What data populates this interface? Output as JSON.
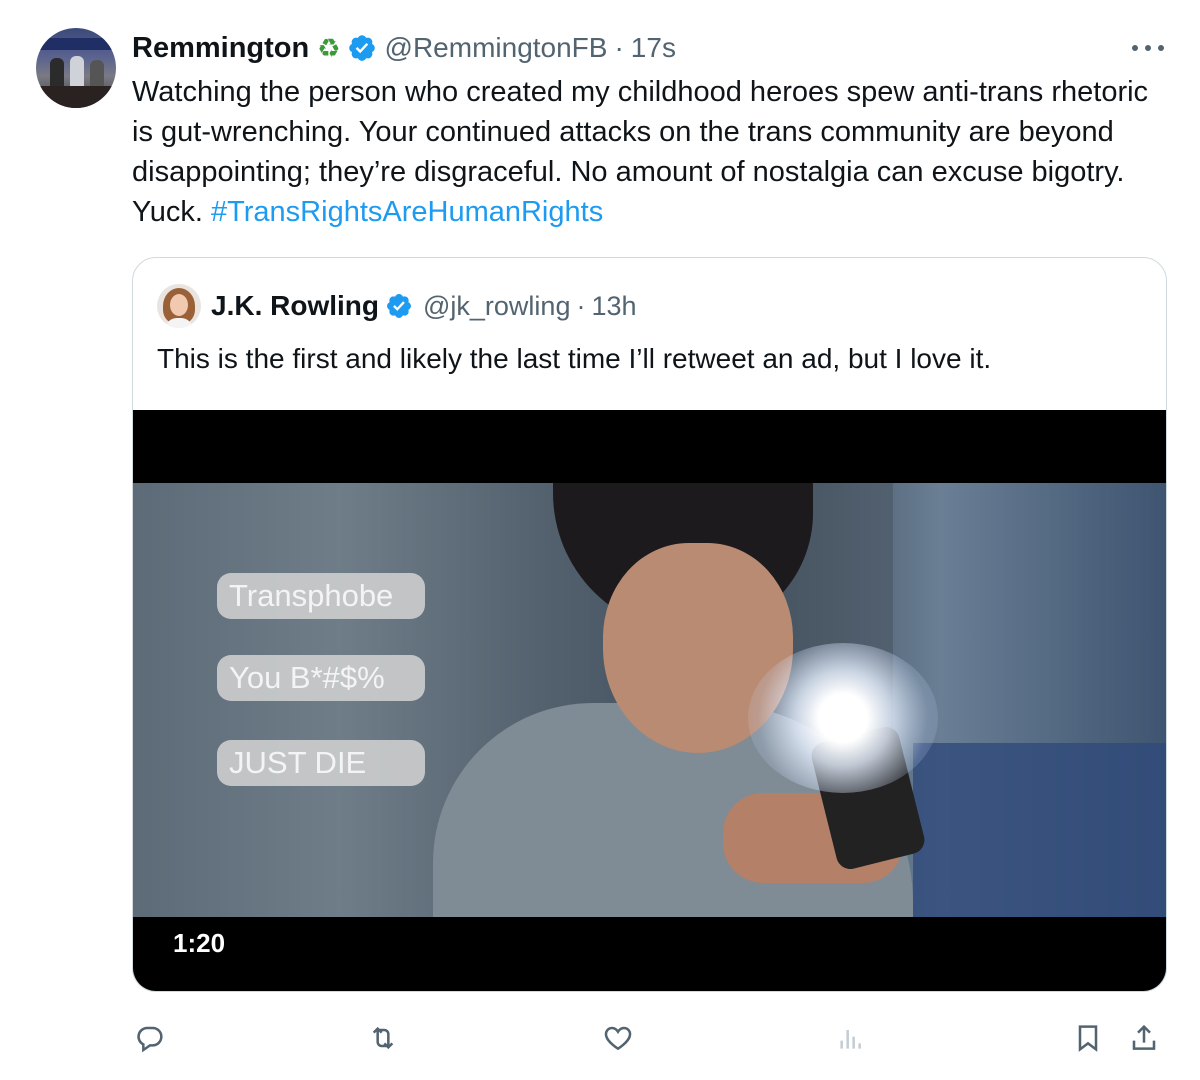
{
  "tweet": {
    "author_name": "Remmington",
    "recycle_emoji": "♻",
    "handle": "@RemmingtonFB",
    "separator": "·",
    "time": "17s",
    "text": "Watching the person who created my childhood heroes spew anti-trans rhetoric is gut-wrenching. Your continued attacks on the trans community are beyond disappointing; they’re disgraceful. No amount of nostalgia can excuse bigotry. Yuck.",
    "hashtag": "#TransRightsAreHumanRights"
  },
  "quote": {
    "author_name": "J.K. Rowling",
    "handle": "@jk_rowling",
    "separator": "·",
    "time": "13h",
    "text": "This is the first and likely the last time I’ll retweet an ad, but I love it.",
    "video": {
      "bubbles": [
        "Transphobe",
        "You B*#$%",
        "JUST DIE"
      ],
      "duration": "1:20"
    }
  },
  "colors": {
    "accent": "#1d9bf0",
    "text": "#0f1419",
    "muted": "#536471",
    "border": "#cfd9de"
  },
  "icons": {
    "verified": "verified-badge-icon",
    "more": "more-icon",
    "reply": "reply-icon",
    "retweet": "retweet-icon",
    "like": "like-icon",
    "views": "views-icon",
    "bookmark": "bookmark-icon",
    "share": "share-icon"
  }
}
